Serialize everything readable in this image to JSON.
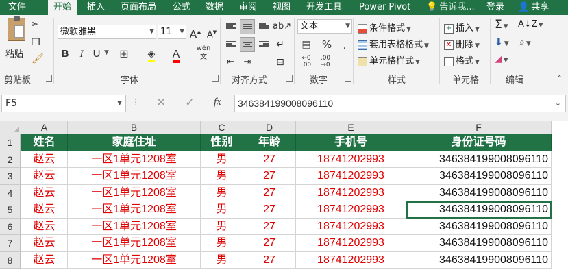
{
  "tabs": [
    {
      "label": "文件"
    },
    {
      "label": "开始"
    },
    {
      "label": "插入"
    },
    {
      "label": "页面布局"
    },
    {
      "label": "公式"
    },
    {
      "label": "数据"
    },
    {
      "label": "审阅"
    },
    {
      "label": "视图"
    },
    {
      "label": "开发工具"
    },
    {
      "label": "Power Pivot"
    }
  ],
  "tell_me": "告诉我...",
  "login": "登录",
  "share": "共享",
  "clipboard": {
    "paste": "粘贴",
    "label": "剪贴板"
  },
  "font": {
    "name": "微软雅黑",
    "size": "11",
    "bold": "B",
    "italic": "I",
    "underline": "U",
    "label": "字体"
  },
  "alignment": {
    "label": "对齐方式"
  },
  "number": {
    "format": "文本",
    "label": "数字"
  },
  "styles": {
    "conditional": "条件格式",
    "table": "套用表格格式",
    "cell": "单元格样式",
    "label": "样式"
  },
  "cells": {
    "insert": "插入",
    "delete": "删除",
    "format": "格式",
    "label": "单元格"
  },
  "editing": {
    "label": "编辑"
  },
  "formula_bar": {
    "name_box": "F5",
    "fx": "fx",
    "value": "346384199008096110"
  },
  "columns": [
    "A",
    "B",
    "C",
    "D",
    "E",
    "F"
  ],
  "rows": [
    "1",
    "2",
    "3",
    "4",
    "5",
    "6",
    "7",
    "8"
  ],
  "table": {
    "headers": [
      "姓名",
      "家庭住址",
      "性别",
      "年龄",
      "手机号",
      "身份证号码"
    ],
    "data": [
      [
        "赵云",
        "一区1单元1208室",
        "男",
        "27",
        "18741202993",
        "346384199008096110"
      ],
      [
        "赵云",
        "一区1单元1208室",
        "男",
        "27",
        "18741202993",
        "346384199008096110"
      ],
      [
        "赵云",
        "一区1单元1208室",
        "男",
        "27",
        "18741202993",
        "346384199008096110"
      ],
      [
        "赵云",
        "一区1单元1208室",
        "男",
        "27",
        "18741202993",
        "346384199008096110"
      ],
      [
        "赵云",
        "一区1单元1208室",
        "男",
        "27",
        "18741202993",
        "346384199008096110"
      ],
      [
        "赵云",
        "一区1单元1208室",
        "男",
        "27",
        "18741202993",
        "346384199008096110"
      ],
      [
        "赵云",
        "一区1单元1208室",
        "男",
        "27",
        "18741202993",
        "346384199008096110"
      ]
    ]
  },
  "colors": {
    "accent": "#217346",
    "data_text": "#e00000",
    "id_text": "#111111"
  }
}
